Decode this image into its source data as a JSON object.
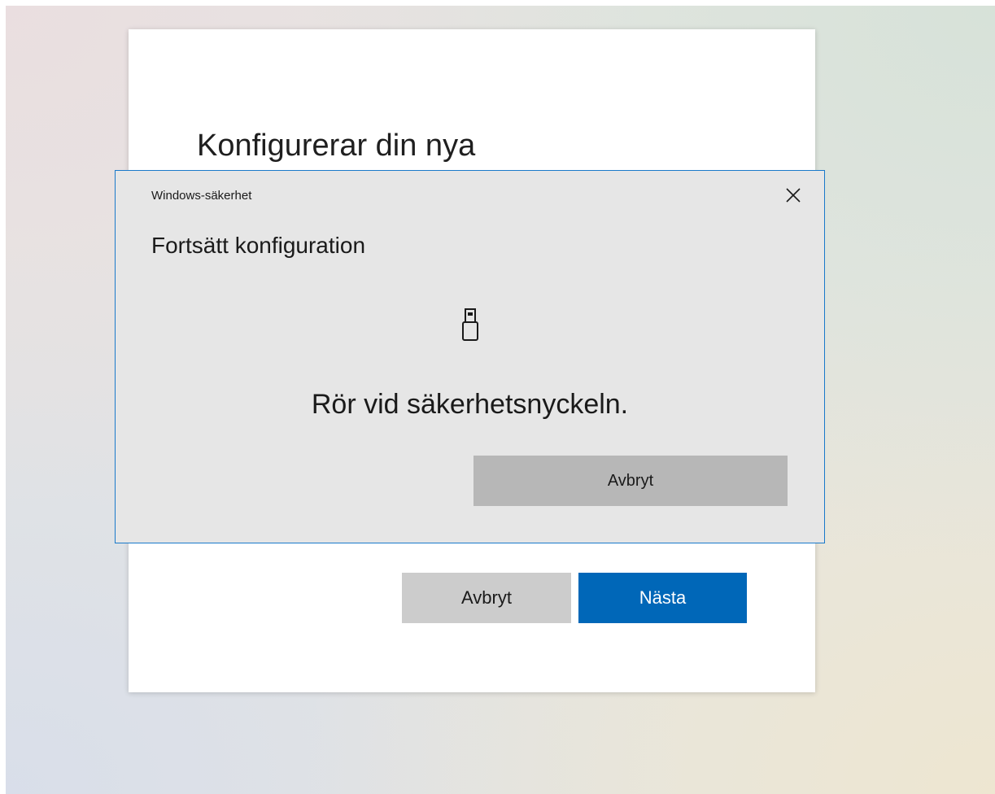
{
  "wizard": {
    "title": "Konfigurerar din nya",
    "cancel_label": "Avbryt",
    "next_label": "Nästa",
    "accent_color": "#0067b8"
  },
  "security_dialog": {
    "app_name": "Windows-säkerhet",
    "heading": "Fortsätt konfiguration",
    "icon": "usb-security-key-icon",
    "message": "Rör vid säkerhetsnyckeln.",
    "cancel_label": "Avbryt",
    "close_icon": "close-icon",
    "border_color": "#1979ca"
  }
}
